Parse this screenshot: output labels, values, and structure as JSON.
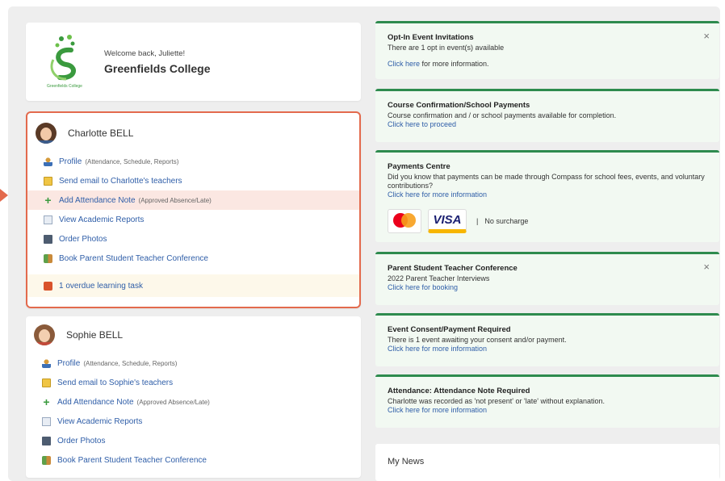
{
  "welcome": {
    "greeting": "Welcome back, Juliette!",
    "school": "Greenfields College",
    "logo_text": "Greenfields College"
  },
  "students": [
    {
      "name": "Charlotte BELL",
      "links": [
        {
          "label": "Profile",
          "sub": "(Attendance, Schedule, Reports)",
          "icon": "profile-icon"
        },
        {
          "label": "Send email to Charlotte's teachers",
          "sub": "",
          "icon": "mail-icon"
        },
        {
          "label": "Add Attendance Note",
          "sub": "(Approved Absence/Late)",
          "icon": "plus-icon"
        },
        {
          "label": "View Academic Reports",
          "sub": "",
          "icon": "report-icon"
        },
        {
          "label": "Order Photos",
          "sub": "",
          "icon": "photo-icon"
        },
        {
          "label": "Book Parent Student Teacher Conference",
          "sub": "",
          "icon": "conference-icon"
        }
      ],
      "task": "1 overdue learning task"
    },
    {
      "name": "Sophie BELL",
      "links": [
        {
          "label": "Profile",
          "sub": "(Attendance, Schedule, Reports)",
          "icon": "profile-icon"
        },
        {
          "label": "Send email to Sophie's teachers",
          "sub": "",
          "icon": "mail-icon"
        },
        {
          "label": "Add Attendance Note",
          "sub": "(Approved Absence/Late)",
          "icon": "plus-icon"
        },
        {
          "label": "View Academic Reports",
          "sub": "",
          "icon": "report-icon"
        },
        {
          "label": "Order Photos",
          "sub": "",
          "icon": "photo-icon"
        },
        {
          "label": "Book Parent Student Teacher Conference",
          "sub": "",
          "icon": "conference-icon"
        }
      ]
    }
  ],
  "panels": {
    "optin": {
      "title": "Opt-In Event Invitations",
      "text": "There are 1 opt in event(s) available",
      "link": "Click here",
      "link_suffix": " for more information."
    },
    "course": {
      "title": "Course Confirmation/School Payments",
      "text": "Course confirmation and / or school payments available for completion.",
      "link": "Click here to proceed"
    },
    "payments": {
      "title": "Payments Centre",
      "text": "Did you know that payments can be made through Compass for school fees, events, and voluntary contributions?",
      "link": "Click here for more information",
      "visa": "VISA",
      "no_surcharge": "No surcharge",
      "separator": "|"
    },
    "pstc": {
      "title": "Parent Student Teacher Conference",
      "text": "2022 Parent Teacher Interviews",
      "link": "Click here for booking"
    },
    "consent": {
      "title": "Event Consent/Payment Required",
      "text": "There is 1 event awaiting your consent and/or payment.",
      "link": "Click here for more information"
    },
    "attendance": {
      "title": "Attendance: Attendance Note Required",
      "text": "Charlotte was recorded as 'not present' or 'late' without explanation.",
      "link": "Click here for more information"
    }
  },
  "news": {
    "title": "My News"
  },
  "close_glyph": "×",
  "colors": {
    "accent_green": "#2e8b4e",
    "selection": "#e36a4d",
    "link": "#2f5ea8"
  }
}
